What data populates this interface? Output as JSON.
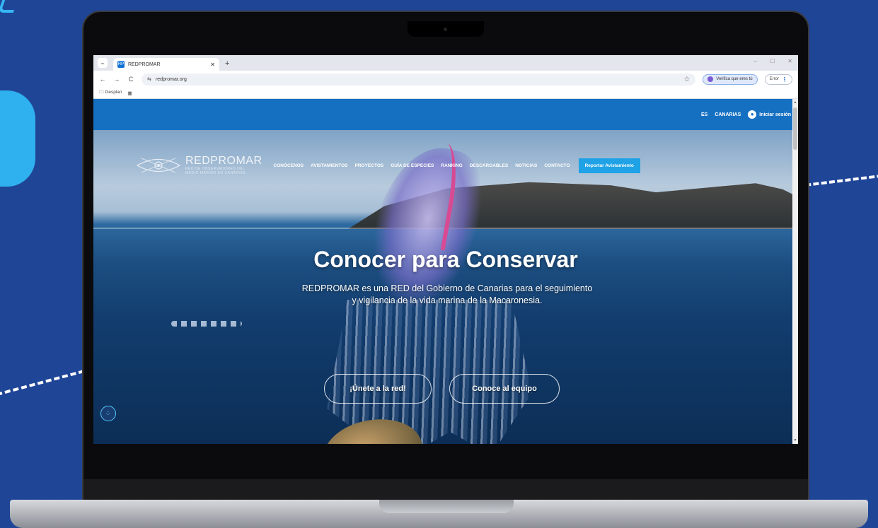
{
  "browser": {
    "tab_title": "REDPROMAR",
    "tab_favicon": "RP",
    "url": "redpromar.org",
    "verify_chip": "Verifica que eres tú",
    "error_chip": "Error",
    "bookmark_item": "Gesplan",
    "win_min": "–",
    "win_max": "☐",
    "win_close": "✕"
  },
  "site": {
    "topbar": {
      "language": "ES",
      "region": "CANARIAS",
      "login": "Iniciar sesión"
    },
    "logo": {
      "name": "REDPROMAR",
      "sub_line1": "RED DE OBSERVADORES DEL",
      "sub_line2": "MEDIO MARINO EN CANARIAS"
    },
    "nav": [
      "CONÓCENOS",
      "AVISTAMIENTOS",
      "PROYECTOS",
      "GUÍA DE ESPECIES",
      "RANKING",
      "DESCARGABLES",
      "NOTICIAS",
      "CONTACTO"
    ],
    "report_button": "Reportar Avistamiento",
    "hero": {
      "title": "Conocer para Conservar",
      "subtitle": "REDPROMAR es una RED del Gobierno de Canarias para el seguimiento y vigilancia de la vida marina de la Macaronesia.",
      "cta_join": "¡Únete a la red!",
      "cta_team": "Conoce al equipo"
    }
  },
  "colors": {
    "page_bg": "#1f4597",
    "accent_light_blue": "#2fb0ef",
    "site_topbar": "#1670c2",
    "report_button": "#1fa2e6"
  }
}
